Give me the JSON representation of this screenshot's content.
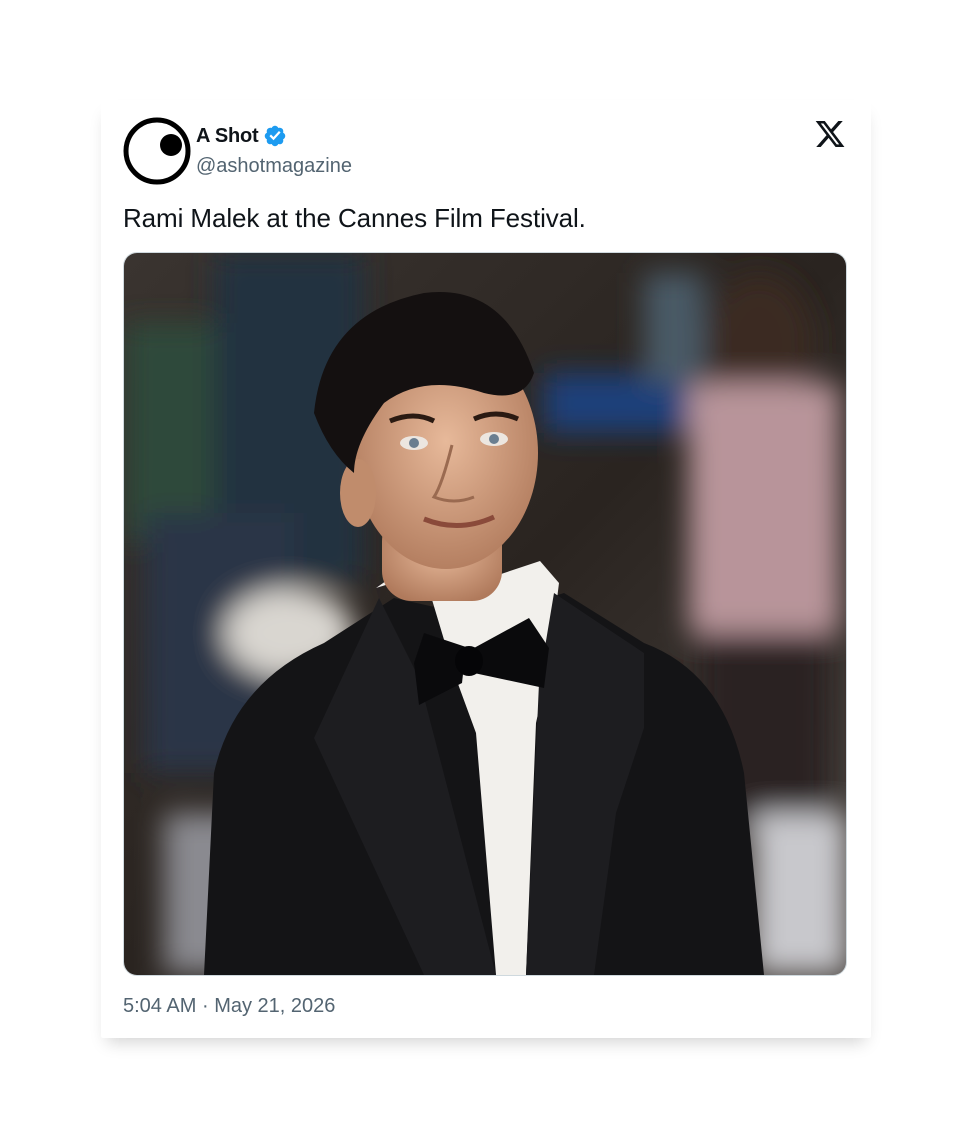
{
  "tweet": {
    "display_name": "A Shot",
    "handle": "@ashotmagazine",
    "verified": true,
    "text": "Rami Malek at the Cannes Film Festival.",
    "time": "5:04 AM",
    "separator": "·",
    "date": "May 21, 2026",
    "media_alt": "Photo of a man in a black tuxedo and bow tie"
  },
  "icons": {
    "avatar": "circle-eye-logo",
    "verified": "verified-badge-icon",
    "platform": "x-logo-icon"
  },
  "colors": {
    "verified_blue": "#1d9bf0",
    "text": "#0f1419",
    "secondary_text": "#536471"
  }
}
